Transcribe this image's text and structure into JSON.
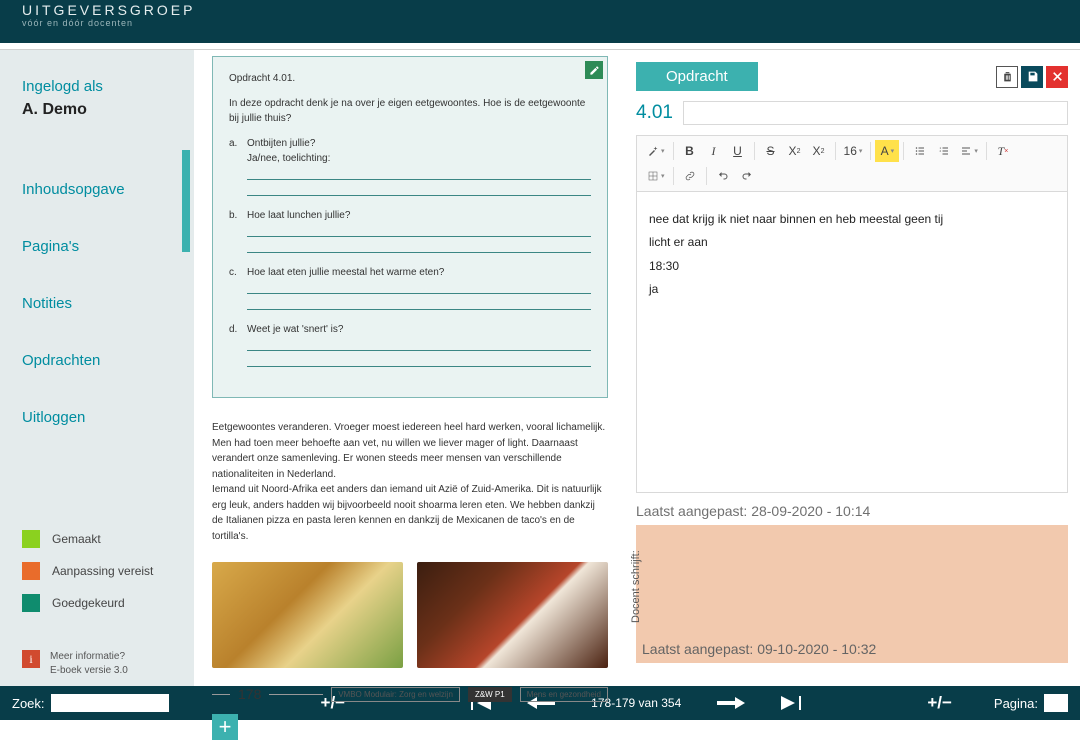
{
  "brand": {
    "title": "UITGEVERSGROEP",
    "subtitle": "vóór en dóór docenten"
  },
  "user": {
    "logged_label": "Ingelogd als",
    "name": "A. Demo"
  },
  "nav": {
    "toc": "Inhoudsopgave",
    "pages": "Pagina's",
    "notes": "Notities",
    "assignments": "Opdrachten",
    "logout": "Uitloggen"
  },
  "legend": {
    "made": "Gemaakt",
    "adjust": "Aanpassing vereist",
    "approved": "Goedgekeurd"
  },
  "legend_colors": {
    "made": "#8bd11f",
    "adjust": "#e96c2b",
    "approved": "#0f8c6e"
  },
  "info": {
    "line1": "Meer informatie?",
    "line2": "E-boek versie 3.0"
  },
  "assignment": {
    "title": "Opdracht 4.01.",
    "intro": "In deze opdracht denk je na over je eigen eetgewoontes. Hoe is de eetgewoonte bij jullie thuis?",
    "a1": "Ontbijten jullie?",
    "a2": "Ja/nee, toelichting:",
    "b": "Hoe laat lunchen jullie?",
    "c": "Hoe laat eten jullie meestal het warme eten?",
    "d": "Weet je wat 'snert' is?"
  },
  "body_p1": "Eetgewoontes veranderen. Vroeger moest iedereen heel hard werken, vooral lichamelijk. Men had toen meer behoefte aan vet, nu willen we liever mager of light. Daarnaast verandert onze samenleving. Er wonen steeds meer mensen van verschillende nationaliteiten in Nederland.",
  "body_p2": "Iemand uit Noord-Afrika eet anders dan iemand uit Azië of Zuid-Amerika. Dit is natuurlijk erg leuk, anders hadden wij bijvoorbeeld nooit shoarma leren eten. We hebben dankzij de Italianen pizza en pasta leren kennen en dankzij de Mexicanen de taco's en de tortilla's.",
  "page_num": "178",
  "chips": {
    "a": "VMBO Modulair: Zorg en welzijn",
    "b": "Z&W P1",
    "c": "Mens en gezondheid"
  },
  "editor": {
    "badge": "Opdracht",
    "number": "4.01",
    "fontsize": "16",
    "lines": {
      "l1": "nee dat krijg ik niet naar binnen en heb meestal geen tij",
      "l2": "licht er aan",
      "l3": "18:30",
      "l4": "ja"
    },
    "last_student": "Laatst aangepast: 28-09-2020 - 10:14",
    "teacher_label": "Docent schrijft:",
    "last_teacher": "Laatst aangepast: 09-10-2020 - 10:32"
  },
  "footer": {
    "search_label": "Zoek:",
    "page_indicator": "178-179 van 354",
    "page_label": "Pagina:"
  }
}
